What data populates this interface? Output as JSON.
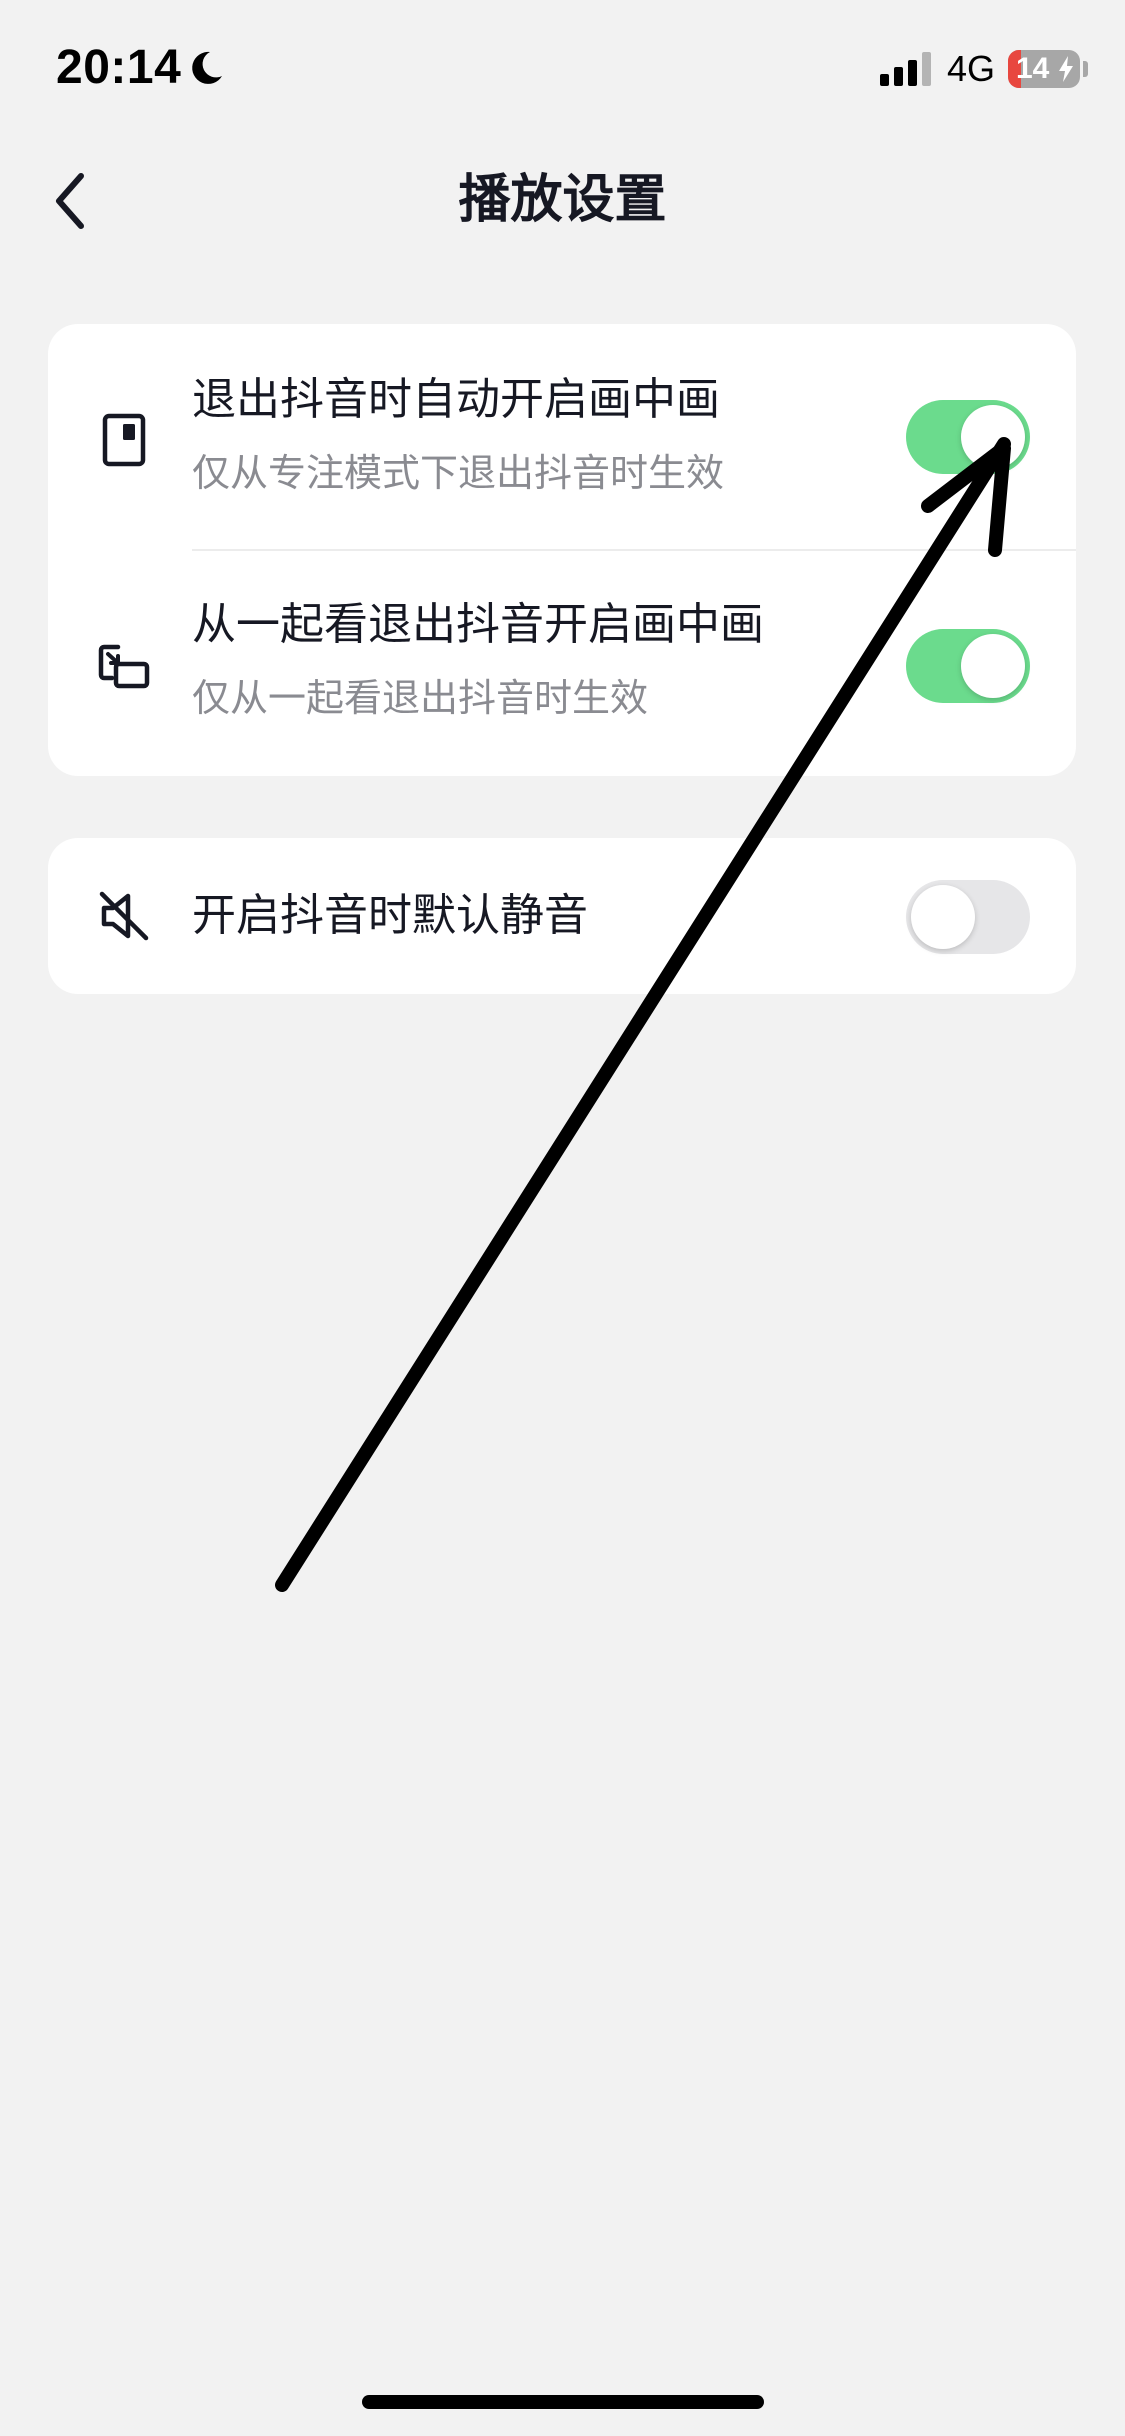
{
  "status_bar": {
    "time": "20:14",
    "network": "4G",
    "battery_level": "14",
    "battery_fraction": 0.14,
    "icons": [
      "moon-icon",
      "signal-icon",
      "battery-icon",
      "bolt-icon"
    ]
  },
  "nav": {
    "back_icon": "chevron-left-icon",
    "title": "播放设置"
  },
  "settings": {
    "group1": [
      {
        "icon": "phone-window-icon",
        "title": "退出抖音时自动开启画中画",
        "subtitle": "仅从专注模式下退出抖音时生效",
        "enabled": true
      },
      {
        "icon": "picture-in-picture-icon",
        "title": "从一起看退出抖音开启画中画",
        "subtitle": "仅从一起看退出抖音时生效",
        "enabled": true
      }
    ],
    "group2": [
      {
        "icon": "mute-icon",
        "title": "开启抖音时默认静音",
        "enabled": false
      }
    ]
  },
  "colors": {
    "background": "#f2f2f2",
    "card": "#ffffff",
    "toggle_on": "#6bdb8d",
    "toggle_off": "#e6e6e8",
    "title_text": "#161823",
    "subtitle_text": "#8a8b91",
    "annotation": "#000000"
  }
}
